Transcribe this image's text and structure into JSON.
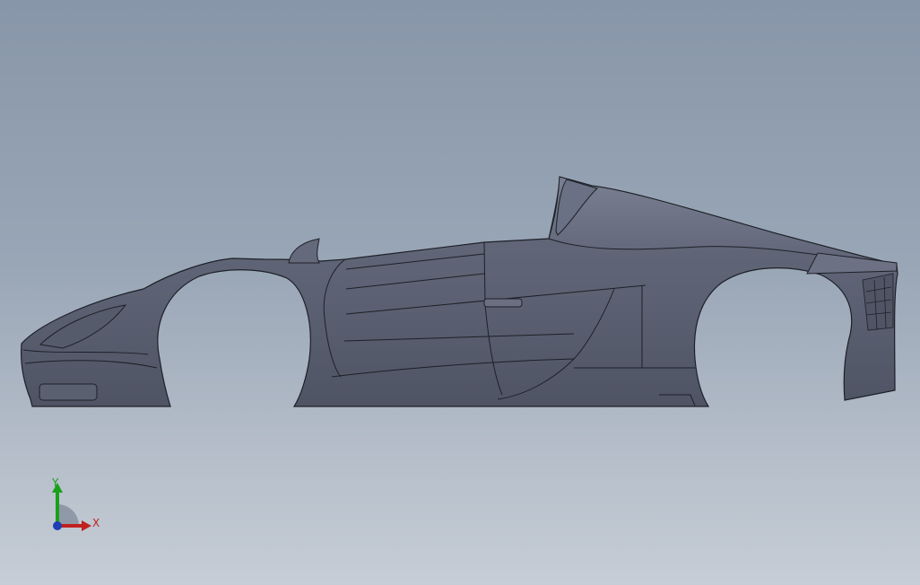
{
  "triad": {
    "x_label": "X",
    "y_label": "Y",
    "x_icon": "x-axis-arrow-icon",
    "y_icon": "y-axis-arrow-icon",
    "origin_icon": "triad-origin-icon"
  },
  "colors": {
    "background_top": "#8896a9",
    "background_bottom": "#c6cdd6",
    "body_fill": "#5f6577",
    "body_edge": "#1d2027",
    "x_axis": "#c0211f",
    "y_axis": "#1aa01a",
    "z_axis": "#1d3fb5"
  }
}
